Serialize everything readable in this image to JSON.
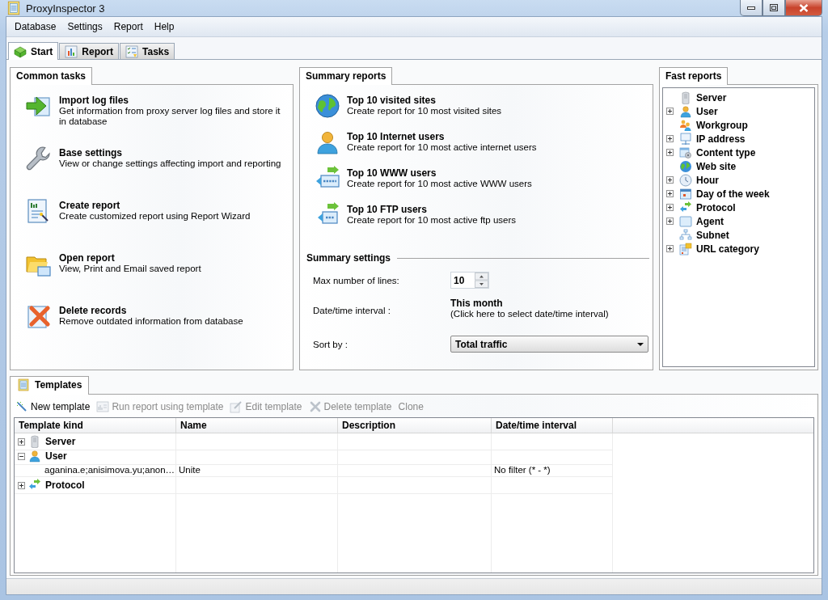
{
  "window": {
    "title": "ProxyInspector 3"
  },
  "menu": [
    "Database",
    "Settings",
    "Report",
    "Help"
  ],
  "tabs": [
    {
      "kind": "start",
      "label": "Start",
      "selected": true
    },
    {
      "kind": "report",
      "label": "Report",
      "selected": false
    },
    {
      "kind": "tasks",
      "label": "Tasks",
      "selected": false
    }
  ],
  "common_tasks": {
    "title": "Common tasks",
    "items": [
      {
        "kind": "import",
        "title": "Import log files",
        "description": "Get information from proxy server log files and store it in  database"
      },
      {
        "kind": "settings",
        "title": "Base settings",
        "description": "View or change settings affecting import and reporting"
      },
      {
        "kind": "create",
        "title": "Create report",
        "description": "Create customized report using Report Wizard"
      },
      {
        "kind": "open",
        "title": "Open report",
        "description": "View, Print and Email saved report"
      },
      {
        "kind": "delete",
        "title": "Delete records",
        "description": "Remove outdated information from database"
      }
    ]
  },
  "summary_reports": {
    "title": "Summary reports",
    "items": [
      {
        "kind": "globe",
        "title": "Top 10 visited sites",
        "description": "Create report for  10 most visited sites"
      },
      {
        "kind": "user",
        "title": "Top 10 Internet users",
        "description": "Create report for  10 most active internet users"
      },
      {
        "kind": "http",
        "title": "Top 10 WWW users",
        "description": "Create report for  10 most active WWW users"
      },
      {
        "kind": "ftp",
        "title": "Top 10 FTP users",
        "description": "Create report for  10 most active ftp users"
      }
    ],
    "settings": {
      "title": "Summary settings",
      "max_lines": {
        "label": "Max number of lines:",
        "value": "10"
      },
      "interval": {
        "label": "Date/time interval :",
        "value": "This month",
        "hint": "(Click here to select date/time interval)"
      },
      "sort_by": {
        "label": "Sort by :",
        "value": "Total traffic"
      }
    }
  },
  "fast_reports": {
    "title": "Fast reports",
    "items": [
      {
        "kind": "server",
        "label": "Server",
        "expandable": false
      },
      {
        "kind": "user",
        "label": "User",
        "expandable": true
      },
      {
        "kind": "workgroup",
        "label": "Workgroup",
        "expandable": false
      },
      {
        "kind": "ip",
        "label": "IP address",
        "expandable": true
      },
      {
        "kind": "content",
        "label": "Content type",
        "expandable": true
      },
      {
        "kind": "website",
        "label": "Web site",
        "expandable": false
      },
      {
        "kind": "hour",
        "label": "Hour",
        "expandable": true
      },
      {
        "kind": "day",
        "label": "Day of the week",
        "expandable": true
      },
      {
        "kind": "protocol",
        "label": "Protocol",
        "expandable": true
      },
      {
        "kind": "agent",
        "label": "Agent",
        "expandable": true
      },
      {
        "kind": "subnet",
        "label": "Subnet",
        "expandable": false
      },
      {
        "kind": "url",
        "label": "URL category",
        "expandable": true
      }
    ]
  },
  "templates": {
    "title": "Templates",
    "toolbar": [
      {
        "kind": "new",
        "label": "New template",
        "disabled": false
      },
      {
        "kind": "run",
        "label": "Run report using template",
        "disabled": true
      },
      {
        "kind": "edit",
        "label": "Edit template",
        "disabled": true
      },
      {
        "kind": "delete",
        "label": "Delete template",
        "disabled": true
      },
      {
        "kind": "clone",
        "label": "Clone",
        "disabled": true
      }
    ],
    "columns": [
      "Template kind",
      "Name",
      "Description",
      "Date/time interval"
    ],
    "rows": [
      {
        "kind": "server",
        "label": "Server",
        "expanded": false
      },
      {
        "kind": "user",
        "label": "User",
        "expanded": true,
        "children": [
          {
            "template_kind": "aganina.e;anisimova.yu;anon…",
            "name": "Unite",
            "date_time_interval": "No filter (* - *)"
          }
        ]
      },
      {
        "kind": "protocol",
        "label": "Protocol",
        "expanded": false
      }
    ]
  }
}
